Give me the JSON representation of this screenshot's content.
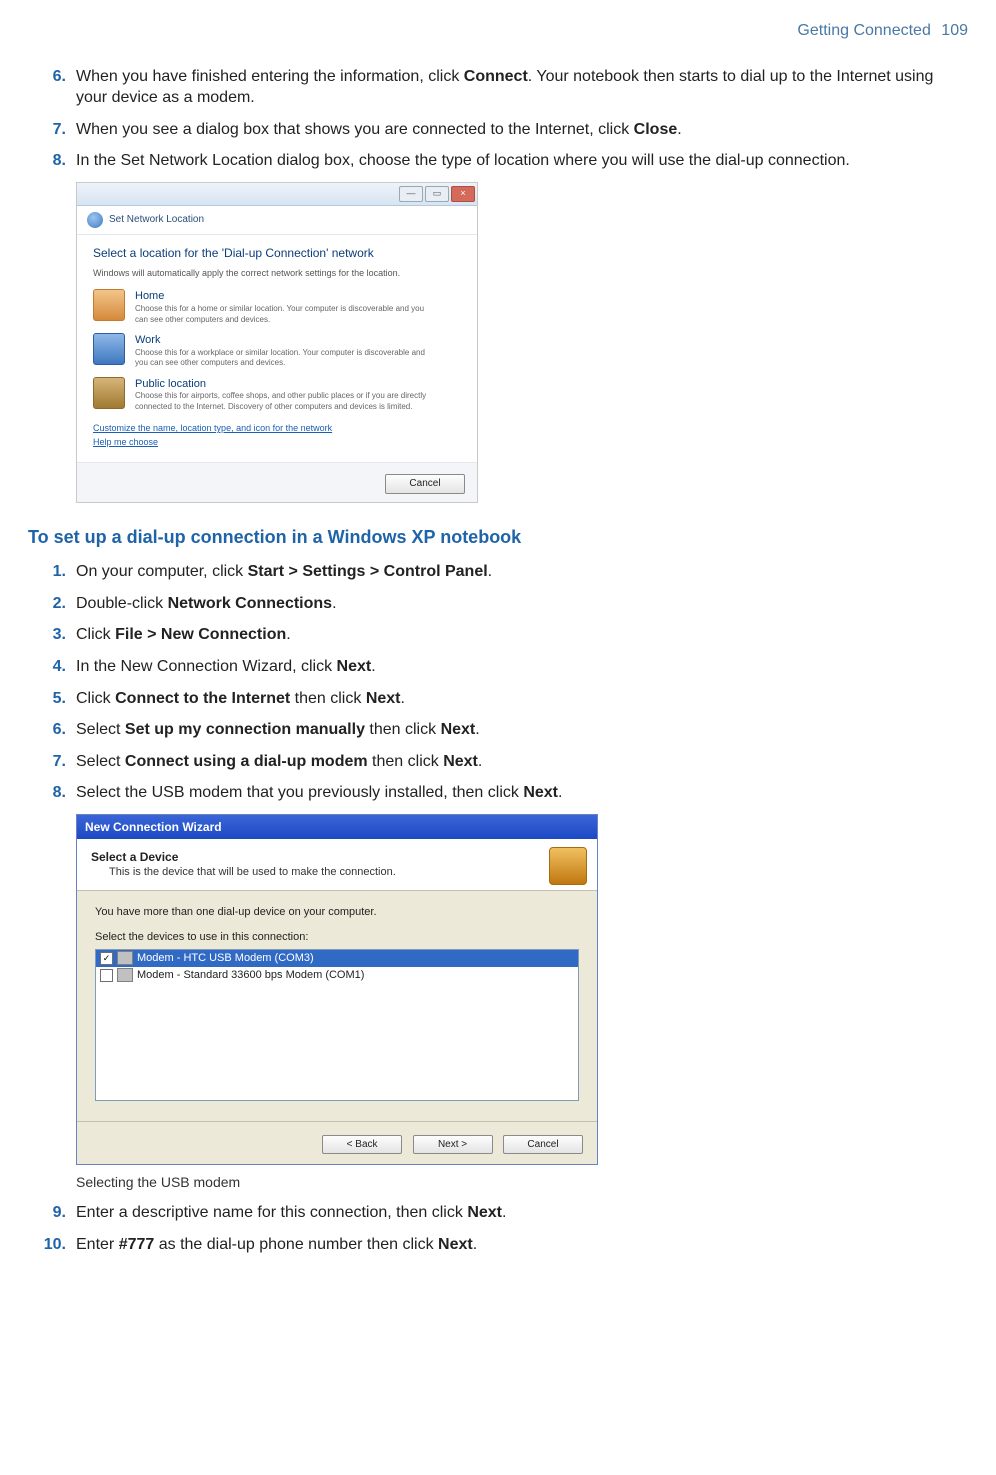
{
  "header": {
    "section": "Getting Connected",
    "page": "109"
  },
  "steps_a": [
    {
      "num": "6.",
      "pre": "When you have finished entering the information, click ",
      "b1": "Connect",
      "post": ". Your notebook then starts to dial up to the Internet using your device as a modem."
    },
    {
      "num": "7.",
      "pre": "When you see a dialog box that shows you are connected to the Internet, click ",
      "b1": "Close",
      "post": "."
    },
    {
      "num": "8.",
      "pre": "In the Set Network Location dialog box, choose the type of location where you will use the dial-up connection.",
      "b1": "",
      "post": ""
    }
  ],
  "shot1": {
    "crumb": "Set Network Location",
    "headline": "Select a location for the 'Dial-up Connection' network",
    "subline": "Windows will automatically apply the correct network settings for the location.",
    "opts": [
      {
        "cls": "home",
        "title": "Home",
        "desc": "Choose this for a home or similar location. Your computer is discoverable and you can see other computers and devices."
      },
      {
        "cls": "work",
        "title": "Work",
        "desc": "Choose this for a workplace or similar location. Your computer is discoverable and you can see other computers and devices."
      },
      {
        "cls": "public",
        "title": "Public location",
        "desc": "Choose this for airports, coffee shops, and other public places or if you are directly connected to the Internet. Discovery of other computers and devices is limited."
      }
    ],
    "link1": "Customize the name, location type, and icon for the network",
    "link2": "Help me choose",
    "cancel": "Cancel",
    "winbtns": {
      "min": "—",
      "max": "▭",
      "close": "×"
    }
  },
  "section2": "To set up a dial-up connection in a Windows XP notebook",
  "steps_b": [
    {
      "num": "1.",
      "pre": "On your computer, click ",
      "b1": "Start > Settings > Control Panel",
      "post": "."
    },
    {
      "num": "2.",
      "pre": "Double-click ",
      "b1": "Network Connections",
      "post": "."
    },
    {
      "num": "3.",
      "pre": "Click ",
      "b1": "File > New Connection",
      "post": "."
    },
    {
      "num": "4.",
      "pre": "In the New Connection Wizard, click ",
      "b1": "Next",
      "post": "."
    },
    {
      "num": "5.",
      "pre": "Click ",
      "b1": "Connect to the Internet",
      "mid": " then click ",
      "b2": "Next",
      "post": "."
    },
    {
      "num": "6.",
      "pre": "Select ",
      "b1": "Set up my connection manually",
      "mid": " then click ",
      "b2": "Next",
      "post": "."
    },
    {
      "num": "7.",
      "pre": "Select ",
      "b1": "Connect using a dial-up modem",
      "mid": " then click ",
      "b2": "Next",
      "post": "."
    },
    {
      "num": "8.",
      "pre": "Select the USB modem that you previously installed, then click ",
      "b1": "Next",
      "post": "."
    }
  ],
  "shot2": {
    "title": "New Connection Wizard",
    "h1": "Select a Device",
    "h2": "This is the device that will be used to make the connection.",
    "hint": "You have more than one dial-up device on your computer.",
    "label": "Select the devices to use in this connection:",
    "rows": [
      {
        "sel": true,
        "checked": true,
        "text": "Modem - HTC USB Modem (COM3)"
      },
      {
        "sel": false,
        "checked": false,
        "text": "Modem - Standard 33600 bps Modem (COM1)"
      }
    ],
    "back": "< Back",
    "next": "Next >",
    "cancel": "Cancel"
  },
  "caption2": "Selecting the USB modem",
  "steps_c": [
    {
      "num": "9.",
      "pre": "Enter a descriptive name for this connection, then click ",
      "b1": "Next",
      "post": "."
    },
    {
      "num": "10.",
      "pre": "Enter ",
      "b1": "#777",
      "mid": " as the dial-up phone number then click ",
      "b2": "Next",
      "post": "."
    }
  ]
}
